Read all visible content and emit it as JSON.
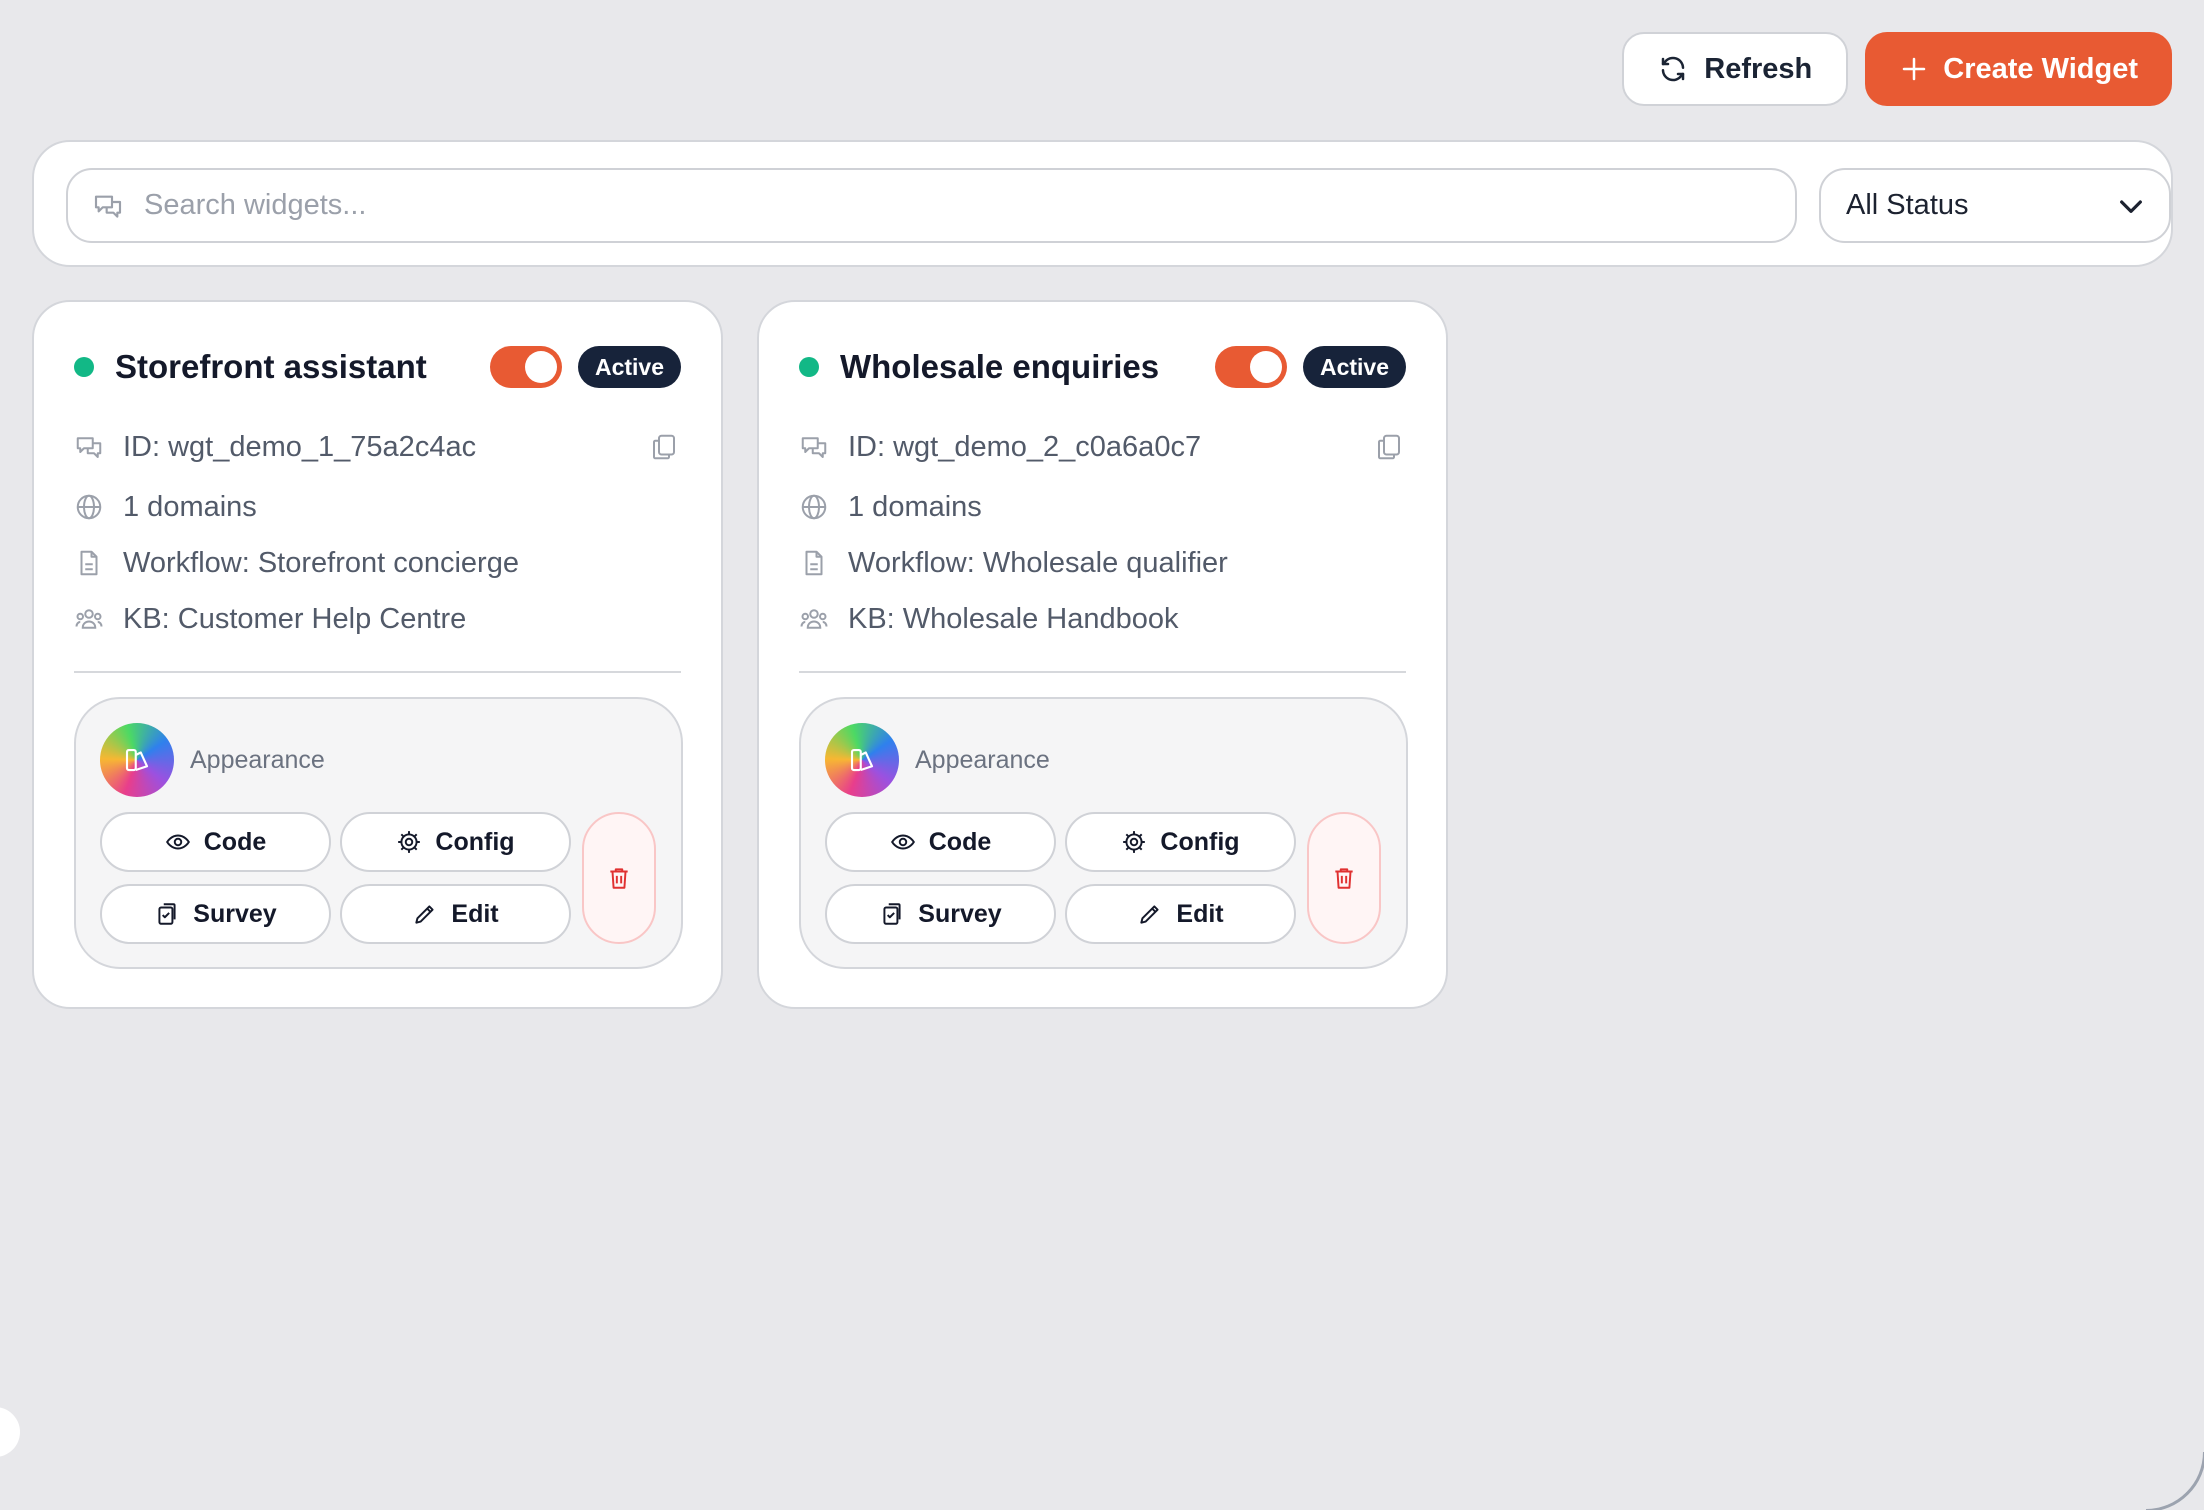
{
  "toolbar": {
    "refresh_label": "Refresh",
    "refresh_icon": "refresh-icon",
    "create_label": "Create Widget",
    "create_icon": "plus-icon"
  },
  "search": {
    "placeholder": "Search widgets...",
    "icon": "chat-bubble-icon"
  },
  "status_filter": {
    "selected": "All Status",
    "icon": "chevron-down-icon"
  },
  "colors": {
    "accent": "#e85a33",
    "badge_bg": "#17233a",
    "status_online": "#12b886",
    "danger": "#e03131",
    "background": "#e8e8eb"
  },
  "widgets": [
    {
      "title": "Storefront assistant",
      "enabled": true,
      "status_badge": "Active",
      "id_text": "ID: wgt_demo_1_75a2c4ac",
      "domains_text": "1 domains",
      "workflow_text": "Workflow: Storefront concierge",
      "kb_text": "KB: Customer Help Centre",
      "appearance_label": "Appearance",
      "actions": {
        "code": "Code",
        "config": "Config",
        "survey": "Survey",
        "edit": "Edit"
      }
    },
    {
      "title": "Wholesale enquiries",
      "enabled": true,
      "status_badge": "Active",
      "id_text": "ID: wgt_demo_2_c0a6a0c7",
      "domains_text": "1 domains",
      "workflow_text": "Workflow: Wholesale qualifier",
      "kb_text": "KB: Wholesale Handbook",
      "appearance_label": "Appearance",
      "actions": {
        "code": "Code",
        "config": "Config",
        "survey": "Survey",
        "edit": "Edit"
      }
    }
  ]
}
